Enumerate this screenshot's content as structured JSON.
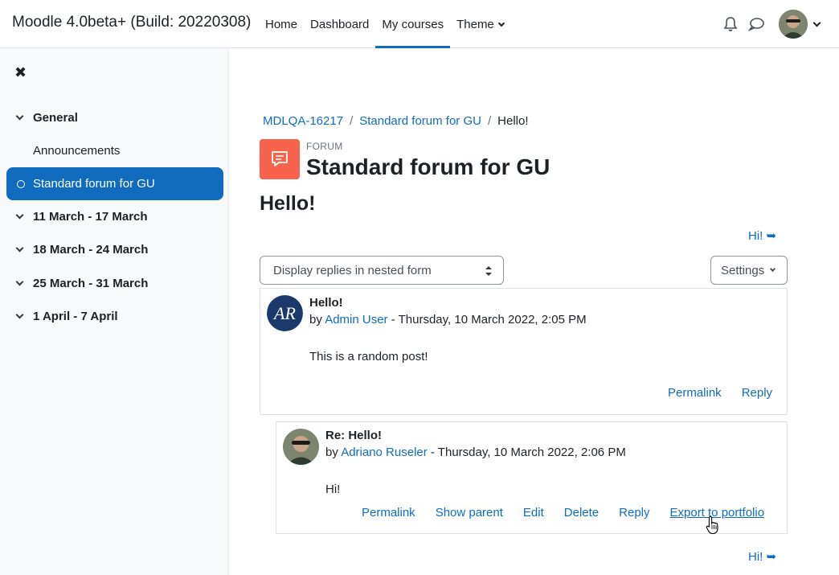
{
  "navbar": {
    "brand": "Moodle 4.0beta+ (Build: 20220308)",
    "nav_items": [
      "Home",
      "Dashboard",
      "My courses",
      "Theme"
    ],
    "active": "My courses"
  },
  "drawer": {
    "close_symbol": "✖",
    "sections": [
      {
        "label": "General"
      },
      {
        "label": "11 March - 17 March"
      },
      {
        "label": "18 March - 24 March"
      },
      {
        "label": "25 March - 31 March"
      },
      {
        "label": "1 April - 7 April"
      }
    ],
    "general_items": [
      "Announcements",
      "Standard forum for GU"
    ],
    "active_item": "Standard forum for GU"
  },
  "breadcrumb": [
    "MDLQA-16217",
    "Standard forum for GU",
    "Hello!"
  ],
  "header": {
    "activity_type": "FORUM",
    "title": "Standard forum for GU",
    "discussion": "Hello!"
  },
  "hi_link": "Hi! ➥",
  "controls": {
    "display_mode": "Display replies in nested form",
    "settings_label": "Settings"
  },
  "posts": [
    {
      "subject": "Hello!",
      "by": "by",
      "author": "Admin User",
      "date": " - Thursday, 10 March 2022, 2:05 PM",
      "body": "This is a random post!",
      "actions": [
        "Permalink",
        "Reply"
      ]
    },
    {
      "subject": "Re: Hello!",
      "by": "by",
      "author": "Adriano Ruseler",
      "date": " - Thursday, 10 March 2022, 2:06 PM",
      "body": "Hi!",
      "actions": [
        "Permalink",
        "Show parent",
        "Edit",
        "Delete",
        "Reply",
        "Export to portfolio"
      ]
    }
  ],
  "colors": {
    "primary": "#0f6cbf",
    "forum_icon": "#f7634d",
    "drawer_bg": "#f8f9fa"
  },
  "icons": [
    "bell-icon",
    "chat-icon",
    "user-avatar",
    "forum-icon",
    "close-icon"
  ]
}
